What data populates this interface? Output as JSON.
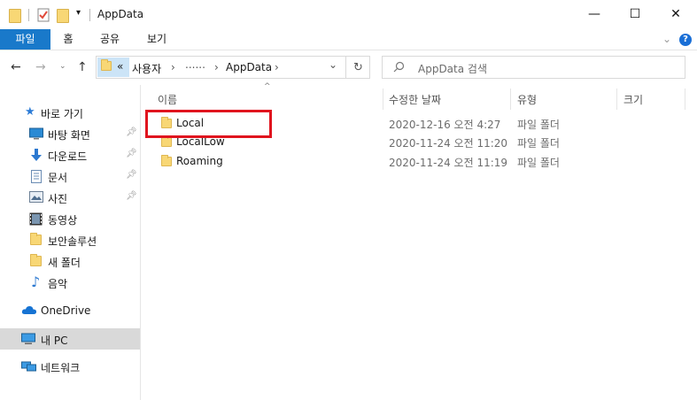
{
  "window": {
    "title": "AppData",
    "minimize": "—",
    "maximize": "☐",
    "close": "✕"
  },
  "ribbon": {
    "tabs": [
      "파일",
      "홈",
      "공유",
      "보기"
    ],
    "collapse": "⌄",
    "help": "?"
  },
  "address": {
    "overflow": "«",
    "segments": [
      "사용자",
      "......",
      "AppData"
    ],
    "sep": "›",
    "dropdown": "⌄",
    "refresh": "↻"
  },
  "search": {
    "placeholder": "AppData 검색"
  },
  "sidebar": {
    "quick_access": "바로 가기",
    "items": [
      "바탕 화면",
      "다운로드",
      "문서",
      "사진",
      "동영상",
      "보안솔루션",
      "새 폴더",
      "음악"
    ],
    "onedrive": "OneDrive",
    "this_pc": "내 PC",
    "network": "네트워크"
  },
  "columns": {
    "name": "이름",
    "modified": "수정한 날짜",
    "type": "유형",
    "size": "크기"
  },
  "rows": [
    {
      "name": "Local",
      "date": "2020-12-16 오전 4:27",
      "type": "파일 폴더"
    },
    {
      "name": "LocalLow",
      "date": "2020-11-24 오전 11:20",
      "type": "파일 폴더"
    },
    {
      "name": "Roaming",
      "date": "2020-11-24 오전 11:19",
      "type": "파일 폴더"
    }
  ]
}
